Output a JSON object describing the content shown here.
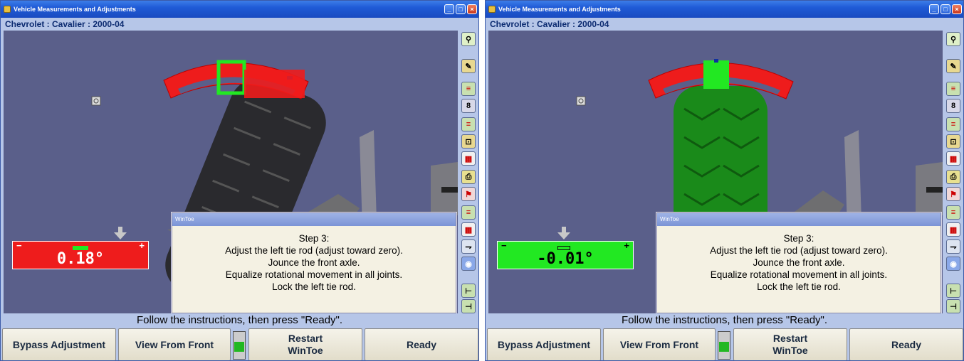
{
  "panels": [
    {
      "title": "Vehicle Measurements and Adjustments",
      "vehicle": "Chevrolet : Cavalier : 2000-04",
      "reading": {
        "value": "0.18°",
        "minus": "−",
        "plus": "+",
        "color": "#ee1c1c",
        "status": "out-of-spec"
      },
      "tire_color": "#2a2a2e",
      "dialog": {
        "title": "WinToe",
        "lines": [
          "Step 3:",
          "Adjust the left tie rod (adjust toward zero).",
          "Jounce the front axle.",
          "Equalize rotational movement in all joints.",
          "Lock the left tie rod."
        ]
      },
      "instruction": "Follow the instructions, then press \"Ready\".",
      "buttons": {
        "bypass": "Bypass Adjustment",
        "view_front": "View From Front",
        "restart_line1": "Restart",
        "restart_line2": "WinToe",
        "ready": "Ready"
      }
    },
    {
      "title": "Vehicle Measurements and Adjustments",
      "vehicle": "Chevrolet : Cavalier : 2000-04",
      "reading": {
        "value": "-0.01°",
        "minus": "−",
        "plus": "+",
        "color": "#22e822",
        "status": "in-spec"
      },
      "tire_color": "#1a8a1a",
      "dialog": {
        "title": "WinToe",
        "lines": [
          "Step 3:",
          "Adjust the left tie rod (adjust toward zero).",
          "Jounce the front axle.",
          "Equalize rotational movement in all joints.",
          "Lock the left tie rod."
        ]
      },
      "instruction": "Follow the instructions, then press \"Ready\".",
      "buttons": {
        "bypass": "Bypass Adjustment",
        "view_front": "View From Front",
        "restart_line1": "Restart",
        "restart_line2": "WinToe",
        "ready": "Ready"
      }
    }
  ],
  "colors": {
    "viewport_bg": "#5a5f8a",
    "arc_red": "#ee1c1c",
    "arc_green": "#22e822",
    "window_chrome": "#b6c6e8",
    "titlebar_blue": "#1f5ad6",
    "dialog_bg": "#f4f1e3"
  },
  "toolbar_icons": [
    "camera-target-icon",
    "wrench-icon",
    "caster-icon",
    "camber-icon",
    "toe-icon",
    "checkered-flag-icon",
    "steering-icon",
    "print-icon",
    "flag-icon",
    "car-side-icon",
    "globe-icon",
    "axle-icon",
    "axle-2-icon"
  ]
}
